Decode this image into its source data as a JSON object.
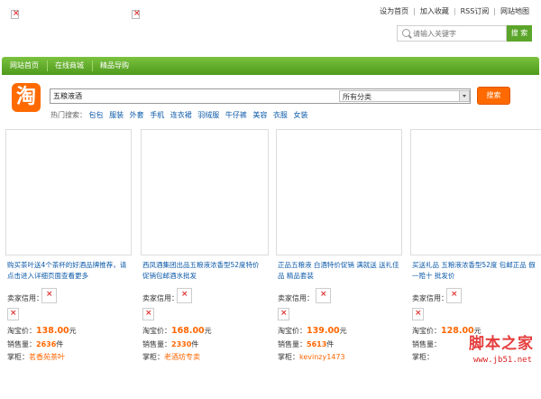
{
  "top_links": [
    "设为首页",
    "加入收藏",
    "RSS订阅",
    "网站地图"
  ],
  "site_search": {
    "placeholder": "请输入关键字",
    "button_label": "搜 索"
  },
  "nav": [
    "网站首页",
    "在线商城",
    "精品导购"
  ],
  "taobao": {
    "logo_char": "淘",
    "query": "五粮液酒",
    "category": "所有分类",
    "button_label": "搜索",
    "hot_label": "热门搜索：",
    "hot_keywords": [
      "包包",
      "服装",
      "外套",
      "手机",
      "连衣裙",
      "羽绒服",
      "牛仔裤",
      "美容",
      "衣服",
      "女装"
    ]
  },
  "cards": [
    {
      "title": "购买茶叶送4个茶杯的好酒品牌推荐，请点击进入详细页面查看更多",
      "seller_label": "卖家信用：",
      "price_label": "淘宝价：",
      "price": "138.00",
      "price_unit": "元",
      "sold_label": "销售量：",
      "sold": "2636",
      "sold_unit": "件",
      "addr_label": "掌柜：",
      "addr": "茗香苑茶叶"
    },
    {
      "title": "西凤酒集团出品五粮液浓香型52度特价促销包邮酒水批发",
      "seller_label": "卖家信用：",
      "price_label": "淘宝价：",
      "price": "168.00",
      "price_unit": "元",
      "sold_label": "销售量：",
      "sold": "2330",
      "sold_unit": "件",
      "addr_label": "掌柜：",
      "addr": "老酒坊专卖"
    },
    {
      "title": "正品五粮液 白酒特价促销 满就送 送礼佳品 精品套装",
      "seller_label": "卖家信用：",
      "price_label": "淘宝价：",
      "price": "139.00",
      "price_unit": "元",
      "sold_label": "销售量：",
      "sold": "5613",
      "sold_unit": "件",
      "addr_label": "掌柜：",
      "addr": "kevinzy1473"
    },
    {
      "title": "买送礼品 五粮液浓香型52度 包邮正品 假一赔十 批发价",
      "seller_label": "卖家信用：",
      "price_label": "淘宝价：",
      "price": "128.00",
      "price_unit": "元",
      "sold_label": "销售量：",
      "sold": "",
      "sold_unit": "",
      "addr_label": "掌柜：",
      "addr": ""
    }
  ],
  "watermark": {
    "main": "脚本之家",
    "sub": "www.jb51.net"
  }
}
